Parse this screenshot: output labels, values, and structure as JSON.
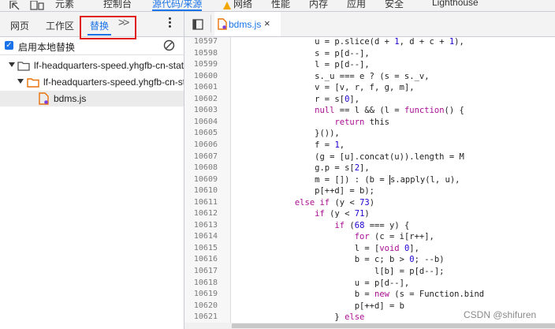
{
  "toolbar": {
    "tabs": [
      {
        "label": "元素"
      },
      {
        "label": "控制台"
      },
      {
        "label": "源代码/来源"
      },
      {
        "label": "网络"
      },
      {
        "label": "性能"
      },
      {
        "label": "内存"
      },
      {
        "label": "应用"
      },
      {
        "label": "安全"
      },
      {
        "label": "Lighthouse"
      }
    ],
    "active_tab": "源代码/来源"
  },
  "navigator": {
    "tabs": [
      {
        "label": "网页"
      },
      {
        "label": "工作区"
      },
      {
        "label": "替换"
      }
    ],
    "active_tab": "替换",
    "more_tabs_label": ">>",
    "enable_overrides_label": "启用本地替换",
    "enable_overrides_checked": true,
    "tree": [
      {
        "label": "lf-headquarters-speed.yhgfb-cn-static.bytedance.net"
      },
      {
        "label": "lf-headquarters-speed.yhgfb-cn-static.bytedance.net"
      },
      {
        "label": "bdms.js"
      }
    ]
  },
  "editor": {
    "open_file": "bdms.js",
    "close_label": "×",
    "lines": [
      {
        "n": "10597",
        "code": "                u = p.slice(d + 1, d + c + 1),"
      },
      {
        "n": "10598",
        "code": "                s = p[d--],"
      },
      {
        "n": "10599",
        "code": "                l = p[d--],"
      },
      {
        "n": "10600",
        "code": "                s._u === e ? (s = s._v,"
      },
      {
        "n": "10601",
        "code": "                v = [v, r, f, g, m],"
      },
      {
        "n": "10602",
        "code": "                r = s[0],"
      },
      {
        "n": "10603",
        "code": "                null == l && (l = function() {"
      },
      {
        "n": "10604",
        "code": "                    return this"
      },
      {
        "n": "10605",
        "code": "                }()),"
      },
      {
        "n": "10606",
        "code": "                f = 1,"
      },
      {
        "n": "10607",
        "code": "                (g = [u].concat(u)).length = M"
      },
      {
        "n": "10608",
        "code": "                g.p = s[2],"
      },
      {
        "n": "10609",
        "code": "                m = []) : (b = |s.apply(l, u),"
      },
      {
        "n": "10610",
        "code": "                p[++d] = b);"
      },
      {
        "n": "10611",
        "code": "            else if (y < 73)"
      },
      {
        "n": "10612",
        "code": "                if (y < 71)"
      },
      {
        "n": "10613",
        "code": "                    if (68 === y) {"
      },
      {
        "n": "10614",
        "code": "                        for (c = i[r++],"
      },
      {
        "n": "10615",
        "code": "                        l = [void 0],"
      },
      {
        "n": "10616",
        "code": "                        b = c; b > 0; --b)"
      },
      {
        "n": "10617",
        "code": "                            l[b] = p[d--];"
      },
      {
        "n": "10618",
        "code": "                        u = p[d--],"
      },
      {
        "n": "10619",
        "code": "                        b = new (s = Function.bind"
      },
      {
        "n": "10620",
        "code": "                        p[++d] = b"
      },
      {
        "n": "10621",
        "code": "                    } else"
      }
    ]
  },
  "watermark": "CSDN @shifuren",
  "colors": {
    "accent": "#1a73e8",
    "highlight_box": "#e01c1c",
    "file_icon": "#e8710a",
    "keyword": "#aa0d91",
    "number": "#1c00cf"
  }
}
